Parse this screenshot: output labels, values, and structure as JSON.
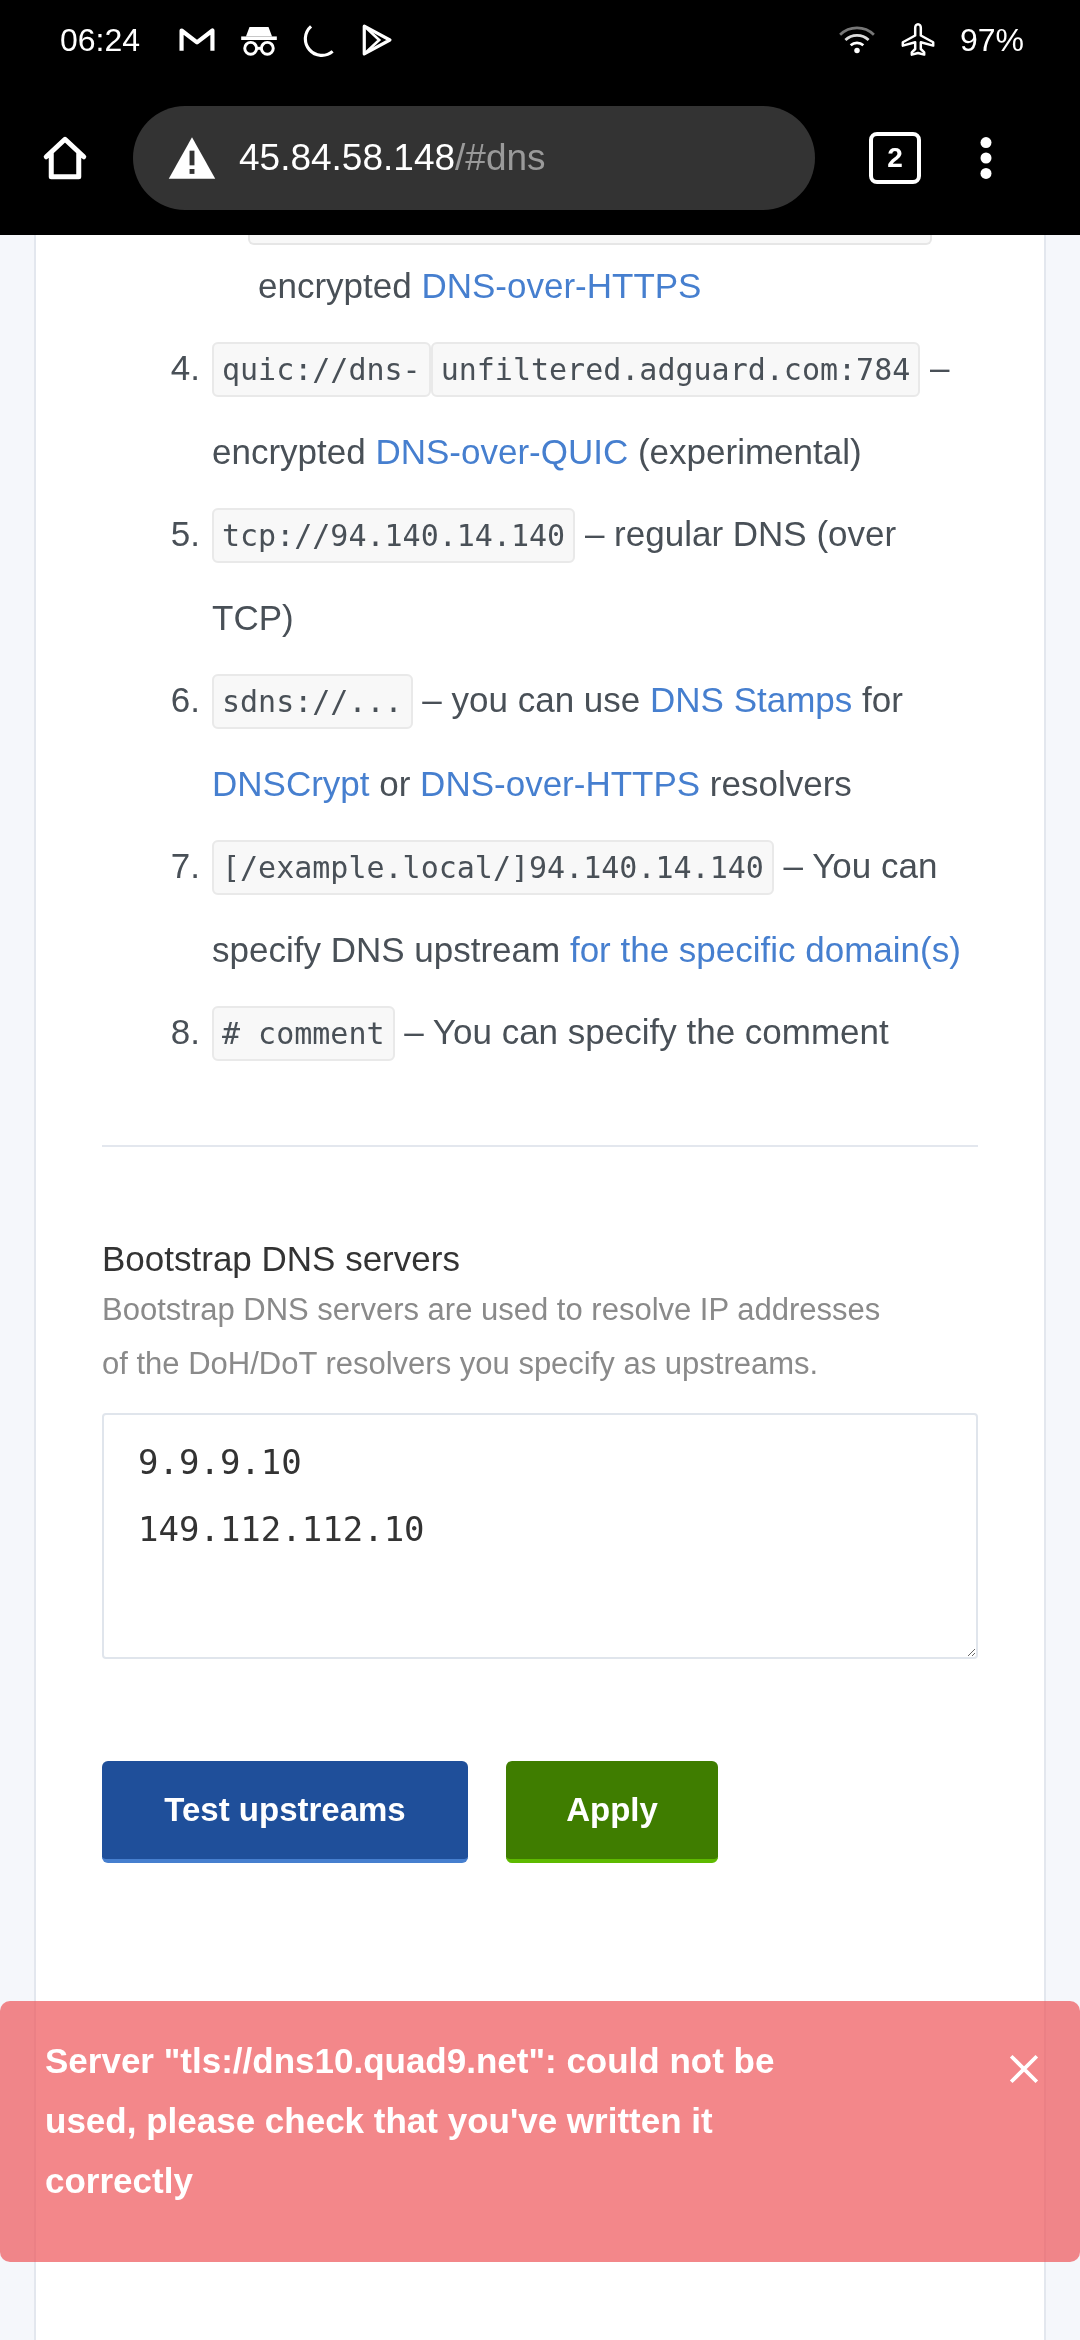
{
  "status_bar": {
    "time": "06:24",
    "battery": "97%"
  },
  "browser": {
    "url_host": "45.84.58.148",
    "url_path": "/#dns",
    "tab_count": "2"
  },
  "upstream_list": {
    "continuation": [
      {
        "kind": "text",
        "text": "encrypted "
      },
      {
        "kind": "link",
        "text": "DNS-over-HTTPS"
      }
    ],
    "items": [
      {
        "number": "4.",
        "parts": [
          {
            "kind": "code",
            "text": "quic://dns-"
          },
          {
            "kind": "code",
            "text": "unfiltered.adguard.com:784"
          },
          {
            "kind": "text",
            "text": " – encrypted "
          },
          {
            "kind": "link",
            "text": "DNS-over-QUIC"
          },
          {
            "kind": "text",
            "text": " (experimental)"
          }
        ]
      },
      {
        "number": "5.",
        "parts": [
          {
            "kind": "code",
            "text": "tcp://94.140.14.140"
          },
          {
            "kind": "text",
            "text": " – regular DNS (over TCP)"
          }
        ]
      },
      {
        "number": "6.",
        "parts": [
          {
            "kind": "code",
            "text": "sdns://..."
          },
          {
            "kind": "text",
            "text": " – you can use "
          },
          {
            "kind": "link",
            "text": "DNS Stamps"
          },
          {
            "kind": "text",
            "text": " for "
          },
          {
            "kind": "link",
            "text": "DNSCrypt"
          },
          {
            "kind": "text",
            "text": " or "
          },
          {
            "kind": "link",
            "text": "DNS-over-HTTPS"
          },
          {
            "kind": "text",
            "text": " resolvers"
          }
        ]
      },
      {
        "number": "7.",
        "parts": [
          {
            "kind": "code",
            "text": "[/example.local/]94.140.14.140"
          },
          {
            "kind": "text",
            "text": " – You can specify DNS upstream "
          },
          {
            "kind": "link",
            "text": "for the specific domain(s)"
          }
        ]
      },
      {
        "number": "8.",
        "parts": [
          {
            "kind": "code",
            "text": "# comment"
          },
          {
            "kind": "text",
            "text": " – You can specify the comment"
          }
        ]
      }
    ]
  },
  "bootstrap": {
    "title": "Bootstrap DNS servers",
    "description": "Bootstrap DNS servers are used to resolve IP addresses of the DoH/DoT resolvers you specify as upstreams.",
    "servers": "9.9.9.10\n149.112.112.10"
  },
  "buttons": [
    {
      "label": "Test upstreams",
      "kind": "primary"
    },
    {
      "label": "Apply",
      "kind": "success"
    }
  ],
  "toast": {
    "message": "Server \"tls://dns10.quad9.net\": could not be used, please check that you've written it correctly"
  }
}
